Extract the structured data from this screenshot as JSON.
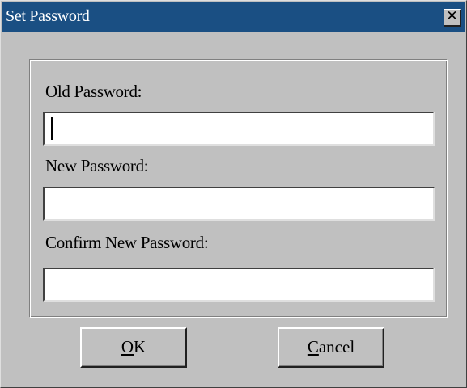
{
  "window": {
    "title": "Set Password",
    "close_glyph": "✕",
    "close_icon": "close-icon"
  },
  "form": {
    "old_password": {
      "label": "Old Password:",
      "value": ""
    },
    "new_password": {
      "label": "New Password:",
      "value": ""
    },
    "confirm_password": {
      "label": "Confirm New Password:",
      "value": ""
    }
  },
  "buttons": {
    "ok": {
      "mnemonic": "O",
      "rest": "K"
    },
    "cancel": {
      "mnemonic": "C",
      "rest": "ancel"
    }
  },
  "colors": {
    "titlebar": "#1a4f83",
    "face": "#c0c0c0"
  }
}
